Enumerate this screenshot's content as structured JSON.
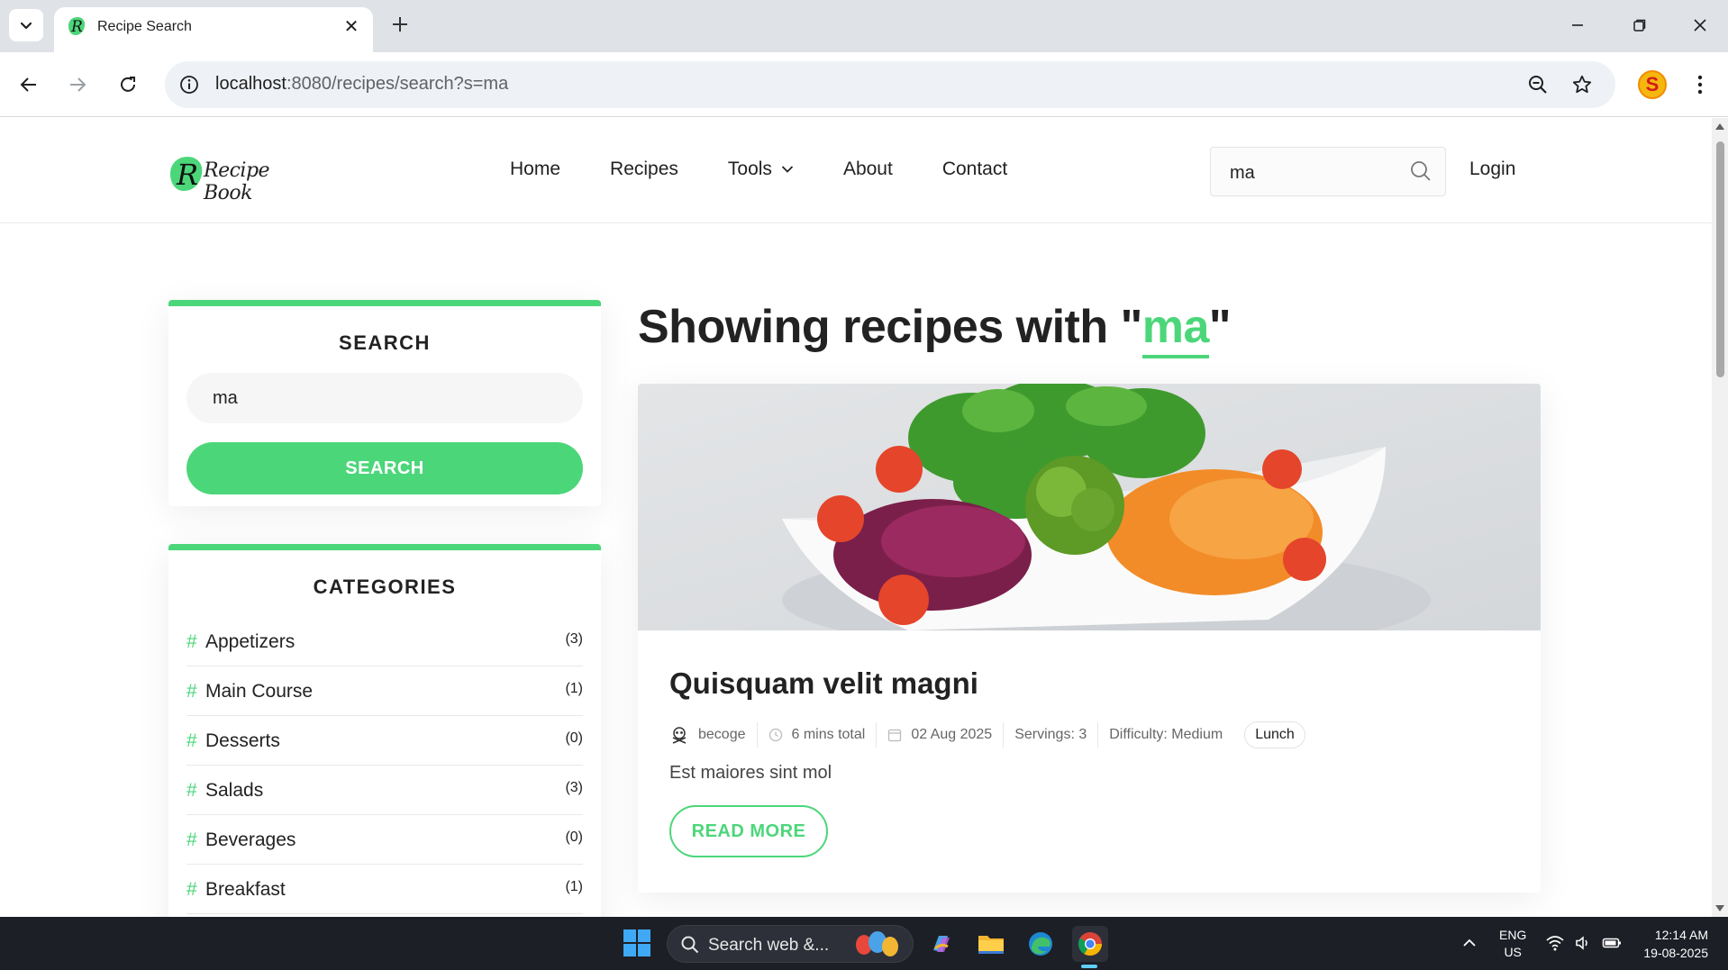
{
  "browser": {
    "tab_title": "Recipe Search",
    "url_host": "localhost",
    "url_rest": ":8080/recipes/search?s=ma",
    "profile_initial": "S"
  },
  "header": {
    "logo_text": "Recipe Book",
    "nav": [
      {
        "label": "Home"
      },
      {
        "label": "Recipes"
      },
      {
        "label": "Tools"
      },
      {
        "label": "About"
      },
      {
        "label": "Contact"
      }
    ],
    "search_value": "ma",
    "login_label": "Login"
  },
  "sidebar": {
    "search_title": "SEARCH",
    "search_value": "ma",
    "search_button": "SEARCH",
    "categories_title": "CATEGORIES",
    "categories": [
      {
        "name": "Appetizers",
        "count": "(3)"
      },
      {
        "name": "Main Course",
        "count": "(1)"
      },
      {
        "name": "Desserts",
        "count": "(0)"
      },
      {
        "name": "Salads",
        "count": "(3)"
      },
      {
        "name": "Beverages",
        "count": "(0)"
      },
      {
        "name": "Breakfast",
        "count": "(1)"
      }
    ]
  },
  "results": {
    "heading_prefix": "Showing recipes with \"",
    "search_term": "ma",
    "heading_suffix": "\""
  },
  "recipe": {
    "title": "Quisquam velit magni",
    "author": "becoge",
    "time": "6 mins total",
    "date": "02 Aug 2025",
    "servings": "Servings: 3",
    "difficulty": "Difficulty: Medium",
    "tag": "Lunch",
    "excerpt": "Est maiores sint mol",
    "read_more": "READ MORE"
  },
  "taskbar": {
    "search_placeholder": "Search web &...",
    "lang_line1": "ENG",
    "lang_line2": "US",
    "time": "12:14 AM",
    "date": "19-08-2025"
  },
  "colors": {
    "accent": "#4cd67a",
    "text": "#222222",
    "taskbar": "#1c1f26"
  }
}
